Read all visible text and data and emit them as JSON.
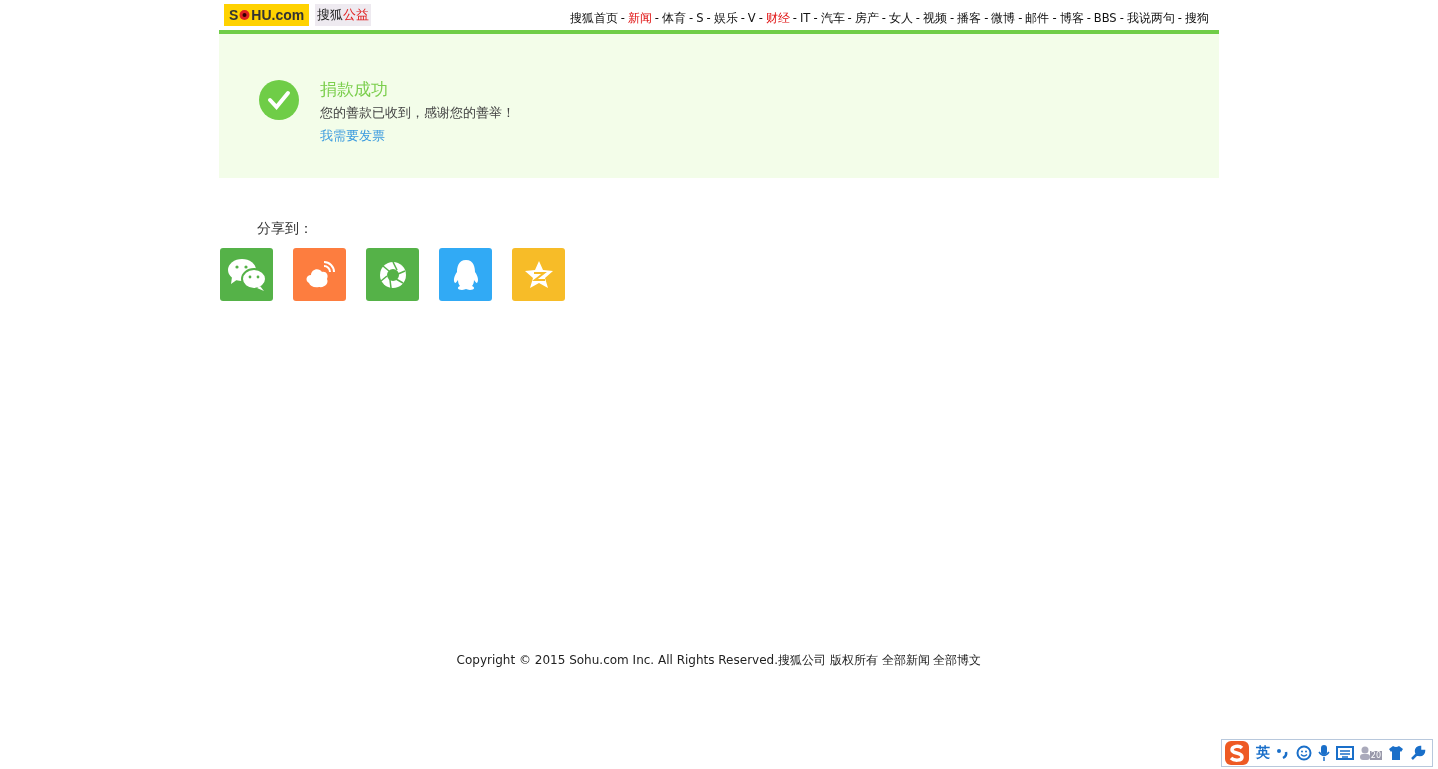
{
  "header": {
    "logo": {
      "left": "S",
      "right": "HU.com"
    },
    "brand": {
      "name": "搜狐",
      "channel": "公益"
    },
    "nav": [
      {
        "label": "搜狐首页",
        "highlighted": false
      },
      {
        "label": "新闻",
        "highlighted": true
      },
      {
        "label": "体育",
        "highlighted": false
      },
      {
        "label": "S",
        "highlighted": false
      },
      {
        "label": "娱乐",
        "highlighted": false
      },
      {
        "label": "V",
        "highlighted": false
      },
      {
        "label": "财经",
        "highlighted": true
      },
      {
        "label": "IT",
        "highlighted": false
      },
      {
        "label": "汽车",
        "highlighted": false
      },
      {
        "label": "房产",
        "highlighted": false
      },
      {
        "label": "女人",
        "highlighted": false
      },
      {
        "label": "视频",
        "highlighted": false
      },
      {
        "label": "播客",
        "highlighted": false
      },
      {
        "label": "微博",
        "highlighted": false
      },
      {
        "label": "邮件",
        "highlighted": false
      },
      {
        "label": "博客",
        "highlighted": false
      },
      {
        "label": "BBS",
        "highlighted": false
      },
      {
        "label": "我说两句",
        "highlighted": false
      },
      {
        "label": "搜狗",
        "highlighted": false
      }
    ],
    "separator": "-"
  },
  "success": {
    "title": "捐款成功",
    "message": "您的善款已收到，感谢您的善举！",
    "link": "我需要发票"
  },
  "share": {
    "label": "分享到：",
    "targets": [
      {
        "kind": "chat",
        "color": "#55b248"
      },
      {
        "kind": "weibo",
        "color": "#fd7d3f"
      },
      {
        "kind": "aperture",
        "color": "#55b248"
      },
      {
        "kind": "penguin",
        "color": "#31aaf5"
      },
      {
        "kind": "star",
        "color": "#f7bc28"
      }
    ]
  },
  "footer": "Copyright © 2015 Sohu.com Inc. All Rights Reserved.搜狐公司 版权所有 全部新闻 全部博文",
  "ime_bar": {
    "mode": "英",
    "badge": "20"
  }
}
